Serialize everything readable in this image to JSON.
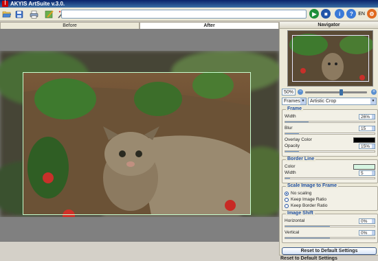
{
  "window": {
    "title": "AKYIS ArtSuite v.3.0.",
    "app_icon": "akvis-logo"
  },
  "toolbar": {
    "icons": [
      "open-icon",
      "save-icon",
      "print-icon",
      "effect-brush-icon",
      "magic-icon"
    ],
    "path_value": "",
    "language": "EN",
    "right_icons": [
      "run-icon",
      "stop-icon",
      "info-icon",
      "help-icon",
      "globe-icon",
      "settings-icon"
    ]
  },
  "tabs": {
    "before": "Before",
    "after": "After"
  },
  "navigator": {
    "title": "Navigator"
  },
  "zoom": {
    "value": "50%",
    "minus": "−",
    "plus": "+",
    "level": 0.55
  },
  "selects": {
    "category": "Frames",
    "effect": "Artistic Crop"
  },
  "frame": {
    "title": "Frame",
    "width_label": "Width",
    "width_value": "26%",
    "width_level": 0.26,
    "blur_label": "Blur",
    "blur_value": "15",
    "blur_level": 0.15,
    "overlay_label": "Overlay Color",
    "overlay_color": "#000000",
    "opacity_label": "Opacity",
    "opacity_value": "15%",
    "opacity_level": 0.15
  },
  "border": {
    "title": "Border Line",
    "color_label": "Color",
    "color_value": "#d7f5e2",
    "width_label": "Width",
    "width_value": "5",
    "width_level": 0.05
  },
  "scale": {
    "title": "Scale Image to Frame",
    "options": [
      "No scaling",
      "Keep Image Ratio",
      "Keep Border Ratio"
    ],
    "selected": 0
  },
  "shift": {
    "title": "Image Shift",
    "horizontal_label": "Horizontal",
    "horizontal_value": "0%",
    "vertical_label": "Vertical",
    "vertical_value": "0%"
  },
  "buttons": {
    "reset": "Reset to Default Settings",
    "status": "Reset to Default Settings"
  }
}
